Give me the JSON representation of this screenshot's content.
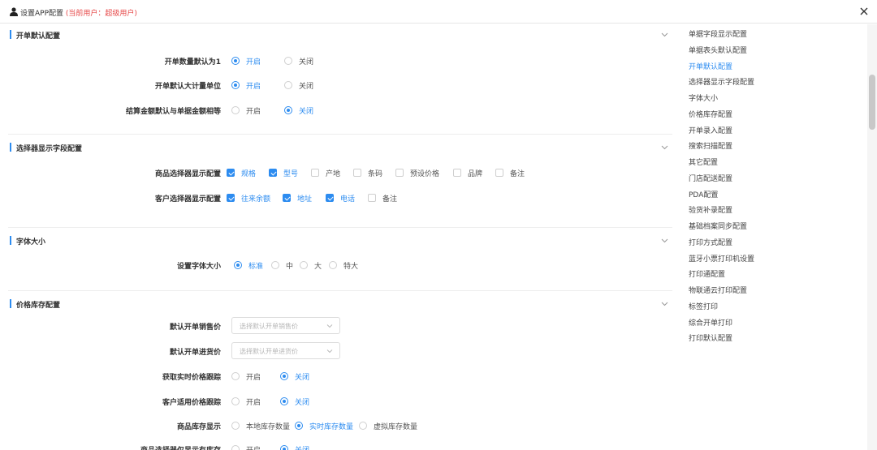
{
  "dialog": {
    "title": "设置APP配置",
    "user_note": "(当前用户：超级用户)",
    "icon": "user-icon",
    "close_icon": "close-icon"
  },
  "sections": {
    "s0": {
      "title": "开单默认配置",
      "rows": [
        {
          "label": "开单数量默认为1",
          "options": [
            "开启",
            "关闭"
          ],
          "selected": "开启"
        },
        {
          "label": "开单默认大计量单位",
          "options": [
            "开启",
            "关闭"
          ],
          "selected": "开启"
        },
        {
          "label": "结算金额默认与单据金额相等",
          "options": [
            "开启",
            "关闭"
          ],
          "selected": "关闭"
        }
      ]
    },
    "s1": {
      "title": "选择器显示字段配置",
      "rows": [
        {
          "label": "商品选择器显示配置",
          "options": [
            "规格",
            "型号",
            "产地",
            "条码",
            "预设价格",
            "品牌",
            "备注"
          ],
          "checked": [
            "规格",
            "型号"
          ]
        },
        {
          "label": "客户选择器显示配置",
          "options": [
            "往来余额",
            "地址",
            "电话",
            "备注"
          ],
          "checked": [
            "往来余额",
            "地址",
            "电话"
          ]
        }
      ]
    },
    "s2": {
      "title": "字体大小",
      "rows": [
        {
          "label": "设置字体大小",
          "options": [
            "标准",
            "中",
            "大",
            "特大"
          ],
          "selected": "标准"
        }
      ]
    },
    "s3": {
      "title": "价格库存配置",
      "rows": [
        {
          "label": "默认开单销售价",
          "placeholder": "选择默认开单销售价"
        },
        {
          "label": "默认开单进货价",
          "placeholder": "选择默认开单进货价"
        },
        {
          "label": "获取实时价格跟踪",
          "options": [
            "开启",
            "关闭"
          ],
          "selected": "关闭"
        },
        {
          "label": "客户适用价格跟踪",
          "options": [
            "开启",
            "关闭"
          ],
          "selected": "关闭"
        },
        {
          "label": "商品库存显示",
          "options": [
            "本地库存数量",
            "实时库存数量",
            "虚拟库存数量"
          ],
          "selected": "实时库存数量"
        },
        {
          "label": "商品选择器仅显示有库存",
          "options": [
            "开启",
            "关闭"
          ],
          "selected": "关闭"
        }
      ]
    }
  },
  "toc": {
    "active": "开单默认配置",
    "items": [
      "单据字段显示配置",
      "单据表头默认配置",
      "开单默认配置",
      "选择器显示字段配置",
      "字体大小",
      "价格库存配置",
      "开单录入配置",
      "搜索扫描配置",
      "其它配置",
      "门店配送配置",
      "PDA配置",
      "验货补录配置",
      "基础档案同步配置",
      "打印方式配置",
      "蓝牙小票打印机设置",
      "打印通配置",
      "物联通云打印配置",
      "标签打印",
      "综合开单打印",
      "打印默认配置"
    ]
  }
}
